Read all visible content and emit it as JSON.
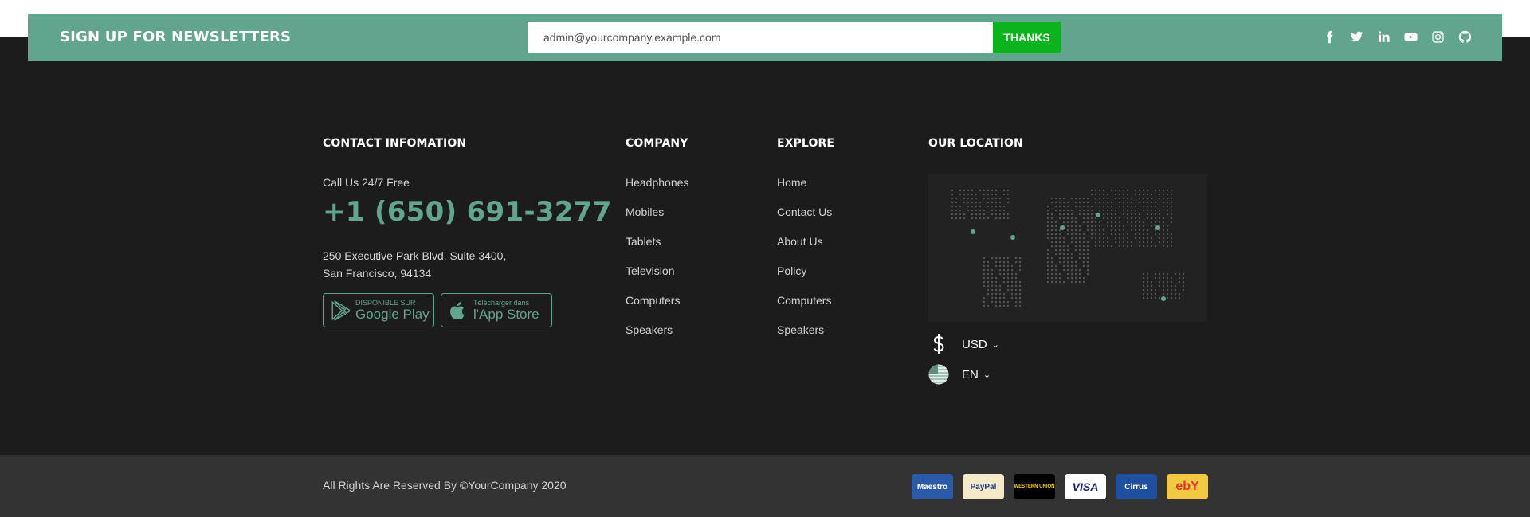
{
  "newsletter": {
    "title": "SIGN UP FOR NEWSLETTERS",
    "input_value": "admin@yourcompany.example.com",
    "button_label": "THANKS",
    "socials": [
      "facebook-icon",
      "twitter-icon",
      "linkedin-icon",
      "youtube-icon",
      "instagram-icon",
      "github-icon"
    ]
  },
  "contact": {
    "title": "CONTACT INFOMATION",
    "call_label": "Call Us 24/7 Free",
    "phone": "+1 (650) 691-3277",
    "address_line1": "250 Executive Park Blvd, Suite 3400,",
    "address_line2": "San Francisco, 94134",
    "google_play": {
      "small": "DISPONIBLE SUR",
      "big": "Google Play"
    },
    "app_store": {
      "small": "Télécharger dans",
      "big": "l'App Store"
    }
  },
  "company": {
    "title": "COMPANY",
    "links": [
      "Headphones",
      "Mobiles",
      "Tablets",
      "Television",
      "Computers",
      "Speakers"
    ]
  },
  "explore": {
    "title": "EXPLORE",
    "links": [
      "Home",
      "Contact Us",
      "About Us",
      "Policy",
      "Computers",
      "Speakers"
    ]
  },
  "location": {
    "title": "OUR LOCATION",
    "currency": "USD",
    "language": "EN"
  },
  "bottom": {
    "copyright": "All Rights Are Reserved By ©YourCompany 2020",
    "payments": [
      {
        "name": "Maestro",
        "bg": "#2b5aa8",
        "fg": "#ffffff"
      },
      {
        "name": "PayPal",
        "bg": "#f4e9c9",
        "fg": "#253b80"
      },
      {
        "name": "WESTERN UNION",
        "bg": "#000000",
        "fg": "#ffd100"
      },
      {
        "name": "VISA",
        "bg": "#ffffff",
        "fg": "#1a1f71"
      },
      {
        "name": "Cirrus",
        "bg": "#1f4f9f",
        "fg": "#ffffff"
      },
      {
        "name": "ebY",
        "bg": "#f3c843",
        "fg": "#e53238"
      }
    ]
  },
  "colors": {
    "accent": "#62a58f",
    "button_green": "#0bb41c",
    "footer_bg": "#1c1c1c",
    "bottom_bar_bg": "#333333"
  }
}
